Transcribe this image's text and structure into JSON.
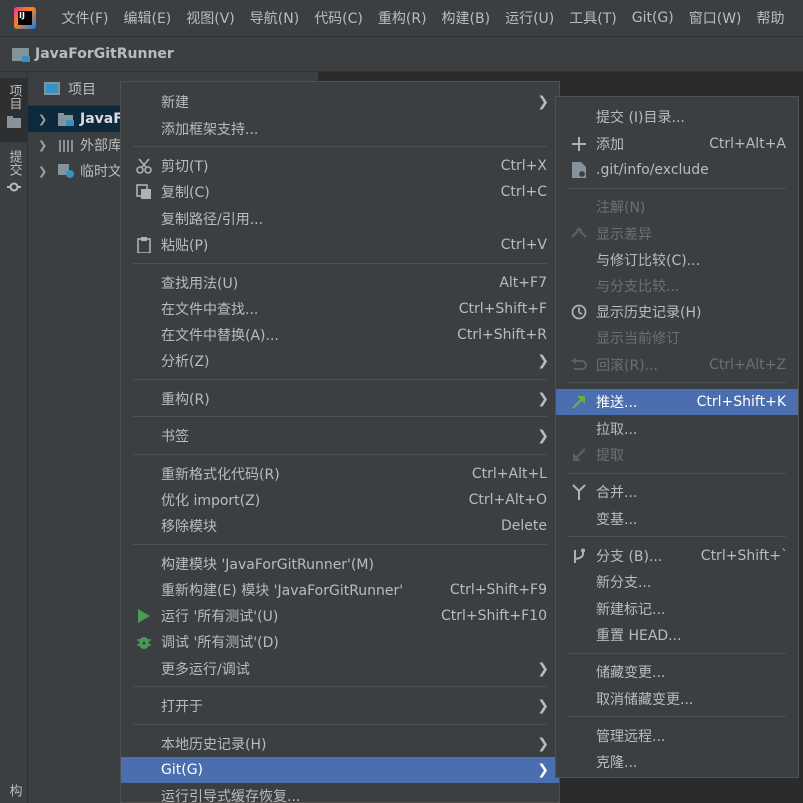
{
  "menubar": {
    "items": [
      "文件(F)",
      "编辑(E)",
      "视图(V)",
      "导航(N)",
      "代码(C)",
      "重构(R)",
      "构建(B)",
      "运行(U)",
      "工具(T)",
      "Git(G)",
      "窗口(W)",
      "帮助"
    ]
  },
  "navbar": {
    "project_name": "JavaForGitRunner"
  },
  "left_strip": {
    "project_tab": "项目",
    "commit_tab": "提交",
    "bottom_tab": "构"
  },
  "project_panel": {
    "title": "项目",
    "tree": [
      {
        "label": "JavaFo",
        "selected": true
      },
      {
        "label": "外部库"
      },
      {
        "label": "临时文"
      }
    ]
  },
  "context_menu": {
    "items": [
      {
        "label": "新建",
        "shortcut": "",
        "submenu": true
      },
      {
        "label": "添加框架支持...",
        "shortcut": ""
      },
      {
        "label": "剪切(T)",
        "shortcut": "Ctrl+X",
        "icon": "scissors-icon"
      },
      {
        "label": "复制(C)",
        "shortcut": "Ctrl+C",
        "icon": "copy-icon"
      },
      {
        "label": "复制路径/引用...",
        "shortcut": ""
      },
      {
        "label": "粘贴(P)",
        "shortcut": "Ctrl+V",
        "icon": "paste-icon"
      },
      {
        "label": "查找用法(U)",
        "shortcut": "Alt+F7"
      },
      {
        "label": "在文件中查找...",
        "shortcut": "Ctrl+Shift+F"
      },
      {
        "label": "在文件中替换(A)...",
        "shortcut": "Ctrl+Shift+R"
      },
      {
        "label": "分析(Z)",
        "shortcut": "",
        "submenu": true
      },
      {
        "label": "重构(R)",
        "shortcut": "",
        "submenu": true
      },
      {
        "label": "书签",
        "shortcut": "",
        "submenu": true
      },
      {
        "label": "重新格式化代码(R)",
        "shortcut": "Ctrl+Alt+L"
      },
      {
        "label": "优化 import(Z)",
        "shortcut": "Ctrl+Alt+O"
      },
      {
        "label": "移除模块",
        "shortcut": "Delete"
      },
      {
        "label": "构建模块 'JavaForGitRunner'(M)",
        "shortcut": ""
      },
      {
        "label": "重新构建(E) 模块 'JavaForGitRunner'",
        "shortcut": "Ctrl+Shift+F9"
      },
      {
        "label": "运行 '所有测试'(U)",
        "shortcut": "Ctrl+Shift+F10",
        "icon": "run-icon"
      },
      {
        "label": "调试 '所有测试'(D)",
        "shortcut": "",
        "icon": "debug-icon"
      },
      {
        "label": "更多运行/调试",
        "shortcut": "",
        "submenu": true
      },
      {
        "label": "打开于",
        "shortcut": "",
        "submenu": true
      },
      {
        "label": "本地历史记录(H)",
        "shortcut": "",
        "submenu": true
      },
      {
        "label": "Git(G)",
        "shortcut": "",
        "submenu": true,
        "highlighted": true
      },
      {
        "label": "运行引导式缓存恢复...",
        "shortcut": ""
      }
    ]
  },
  "git_submenu": {
    "items": [
      {
        "label": "提交 (I)目录...",
        "shortcut": ""
      },
      {
        "label": "添加",
        "shortcut": "Ctrl+Alt+A",
        "icon": "plus-icon"
      },
      {
        "label": ".git/info/exclude",
        "shortcut": "",
        "icon": "file-icon"
      },
      {
        "label": "注解(N)",
        "shortcut": "",
        "disabled": true
      },
      {
        "label": "显示差异",
        "shortcut": "",
        "disabled": true,
        "icon": "diff-icon"
      },
      {
        "label": "与修订比较(C)...",
        "shortcut": ""
      },
      {
        "label": "与分支比较...",
        "shortcut": "",
        "disabled": true
      },
      {
        "label": "显示历史记录(H)",
        "shortcut": "",
        "icon": "clock-icon"
      },
      {
        "label": "显示当前修订",
        "shortcut": "",
        "disabled": true
      },
      {
        "label": "回滚(R)...",
        "shortcut": "Ctrl+Alt+Z",
        "disabled": true,
        "icon": "rollback-icon"
      },
      {
        "label": "推送...",
        "shortcut": "Ctrl+Shift+K",
        "highlighted": true,
        "icon": "push-icon"
      },
      {
        "label": "拉取...",
        "shortcut": ""
      },
      {
        "label": "提取",
        "shortcut": "",
        "disabled": true,
        "icon": "fetch-icon"
      },
      {
        "label": "合并...",
        "shortcut": "",
        "icon": "merge-icon"
      },
      {
        "label": "变基...",
        "shortcut": ""
      },
      {
        "label": "分支 (B)...",
        "shortcut": "Ctrl+Shift+`",
        "icon": "branch-icon"
      },
      {
        "label": "新分支...",
        "shortcut": ""
      },
      {
        "label": "新建标记...",
        "shortcut": ""
      },
      {
        "label": "重置 HEAD...",
        "shortcut": ""
      },
      {
        "label": "储藏变更...",
        "shortcut": ""
      },
      {
        "label": "取消储藏变更...",
        "shortcut": ""
      },
      {
        "label": "管理远程...",
        "shortcut": ""
      },
      {
        "label": "克隆...",
        "shortcut": ""
      }
    ]
  },
  "colors": {
    "highlight": "#4b6eaf",
    "menu_bg": "#3c3f41",
    "text": "#bbbbbb",
    "disabled_text": "#6f6f6f",
    "run_green": "#499c54"
  }
}
